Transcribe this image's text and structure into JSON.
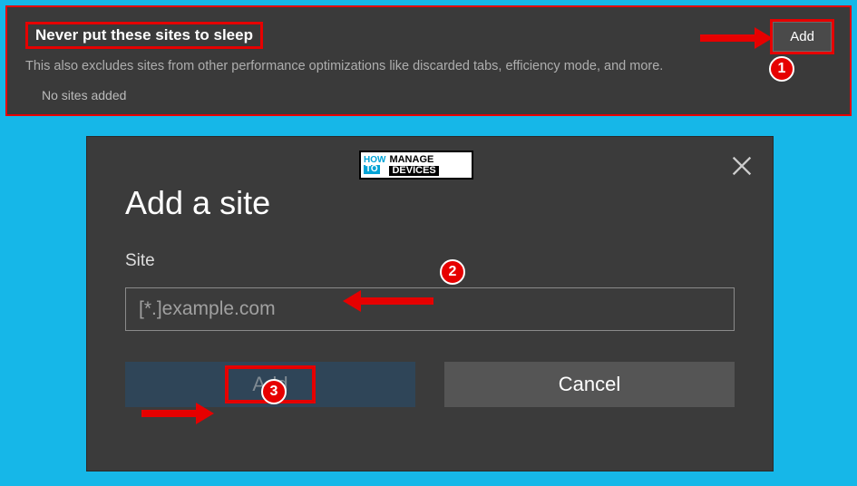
{
  "settings": {
    "title": "Never put these sites to sleep",
    "description": "This also excludes sites from other performance optimizations like discarded tabs, efficiency mode, and more.",
    "empty": "No sites added",
    "add_btn": "Add"
  },
  "dialog": {
    "title": "Add a site",
    "field_label": "Site",
    "placeholder": "[*.]example.com",
    "add": "Add",
    "cancel": "Cancel"
  },
  "badges": {
    "one": "1",
    "two": "2",
    "three": "3"
  },
  "logo": {
    "how": "HOW",
    "to": "TO",
    "manage": "MANAGE",
    "devices": "DEVICES"
  }
}
